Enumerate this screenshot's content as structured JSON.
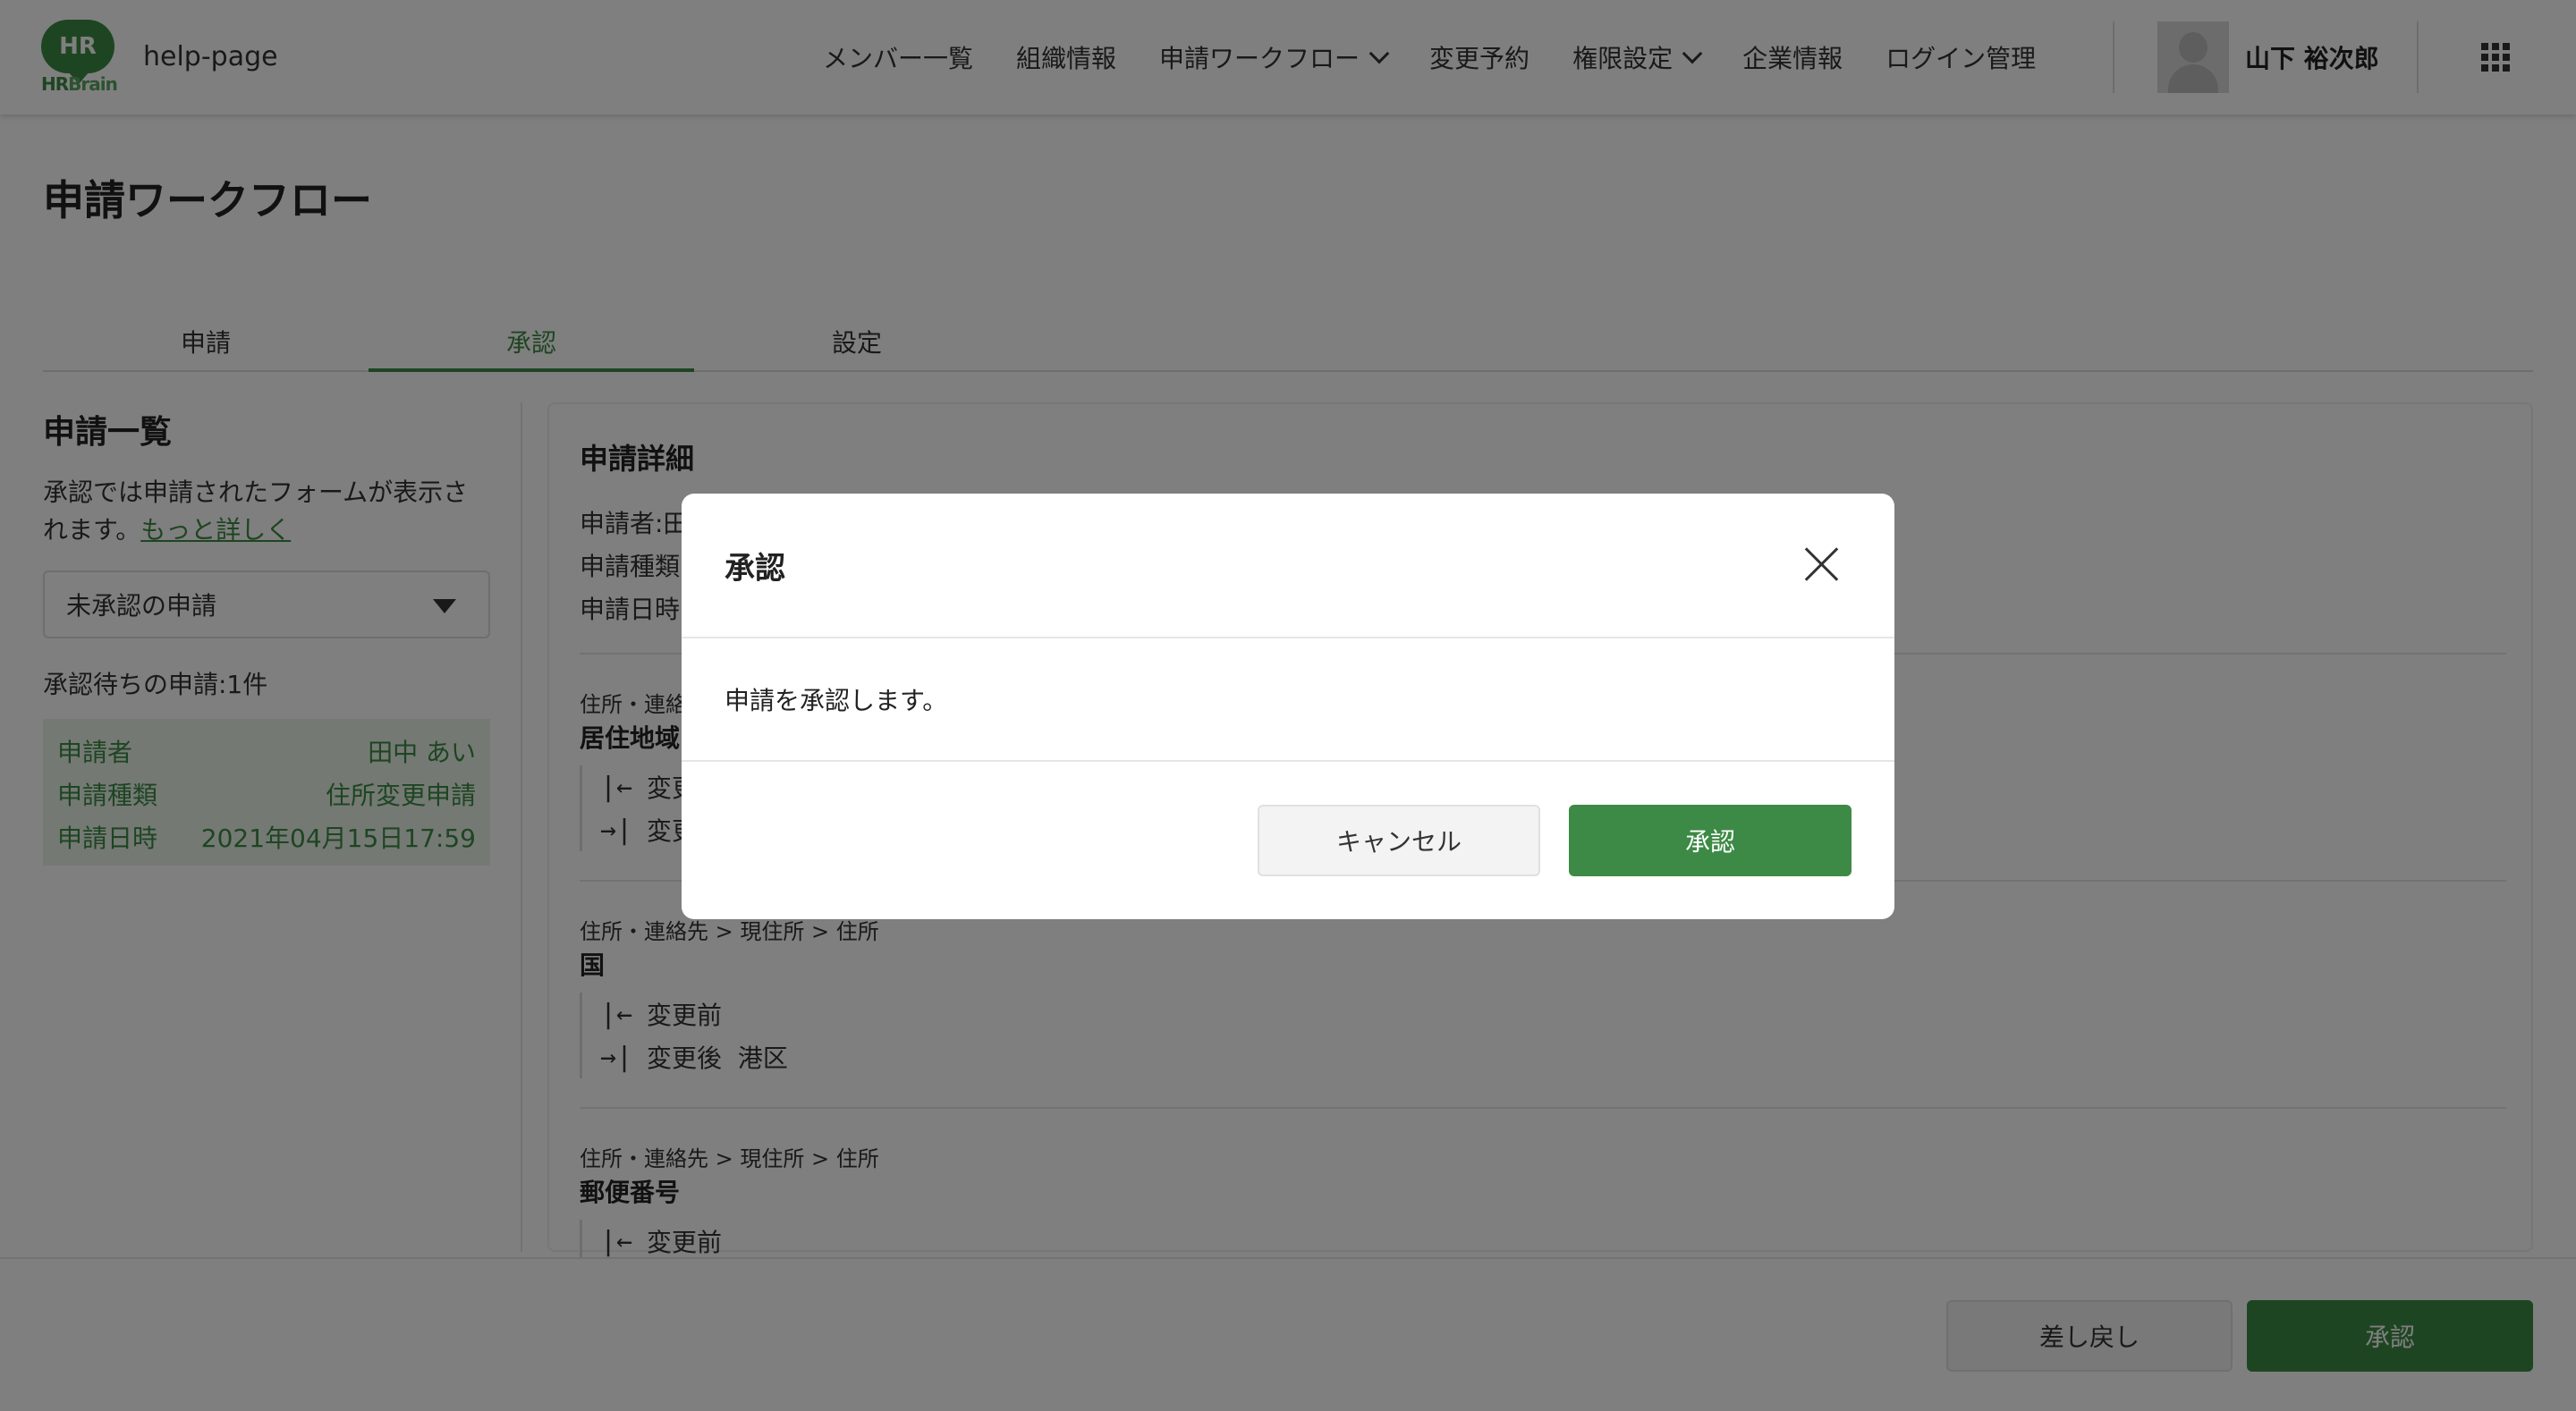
{
  "header": {
    "logo_mark": "HR",
    "logo_text_hr": "HR",
    "logo_text_brain": "Brain",
    "app_name": "help-page",
    "nav": [
      {
        "label": "メンバー一覧",
        "has_dropdown": false
      },
      {
        "label": "組織情報",
        "has_dropdown": false
      },
      {
        "label": "申請ワークフロー",
        "has_dropdown": true
      },
      {
        "label": "変更予約",
        "has_dropdown": false
      },
      {
        "label": "権限設定",
        "has_dropdown": true
      },
      {
        "label": "企業情報",
        "has_dropdown": false
      },
      {
        "label": "ログイン管理",
        "has_dropdown": false
      }
    ],
    "user_name": "山下 裕次郎",
    "apps_icon": "grid-icon"
  },
  "page": {
    "title": "申請ワークフロー",
    "tabs": [
      {
        "label": "申請",
        "active": false
      },
      {
        "label": "承認",
        "active": true
      },
      {
        "label": "設定",
        "active": false
      }
    ]
  },
  "sidebar": {
    "title": "申請一覧",
    "description": "承認では申請されたフォームが表示されます。",
    "more_link": "もっと詳しく",
    "filter_value": "未承認の申請",
    "pending_count": "承認待ちの申請:1件",
    "request": {
      "applicant_label": "申請者",
      "applicant": "田中 あい",
      "type_label": "申請種類",
      "type": "住所変更申請",
      "date_label": "申請日時",
      "date": "2021年04月15日17:59"
    }
  },
  "detail": {
    "title": "申請詳細",
    "applicant_label": "申請者:田",
    "type_label": "申請種類",
    "date_label": "申請日時",
    "sections": [
      {
        "breadcrumb": "住所・連絡先",
        "field": "居住地域",
        "before_label": "変更",
        "after_label": "変更",
        "after_value": ""
      },
      {
        "breadcrumb": "住所・連絡先 > 現住所 > 住所",
        "field": "国",
        "before_label": "変更前",
        "after_label": "変更後",
        "after_value": "港区"
      },
      {
        "breadcrumb": "住所・連絡先 > 現住所 > 住所",
        "field": "郵便番号",
        "before_label": "変更前",
        "after_label": "",
        "after_value": ""
      }
    ]
  },
  "footer": {
    "reject_label": "差し戻し",
    "approve_label": "承認"
  },
  "modal": {
    "title": "承認",
    "message": "申請を承認します。",
    "cancel_label": "キャンセル",
    "confirm_label": "承認"
  },
  "colors": {
    "brand_green": "#3c8a45",
    "overlay": "rgba(0,0,0,0.5)"
  }
}
